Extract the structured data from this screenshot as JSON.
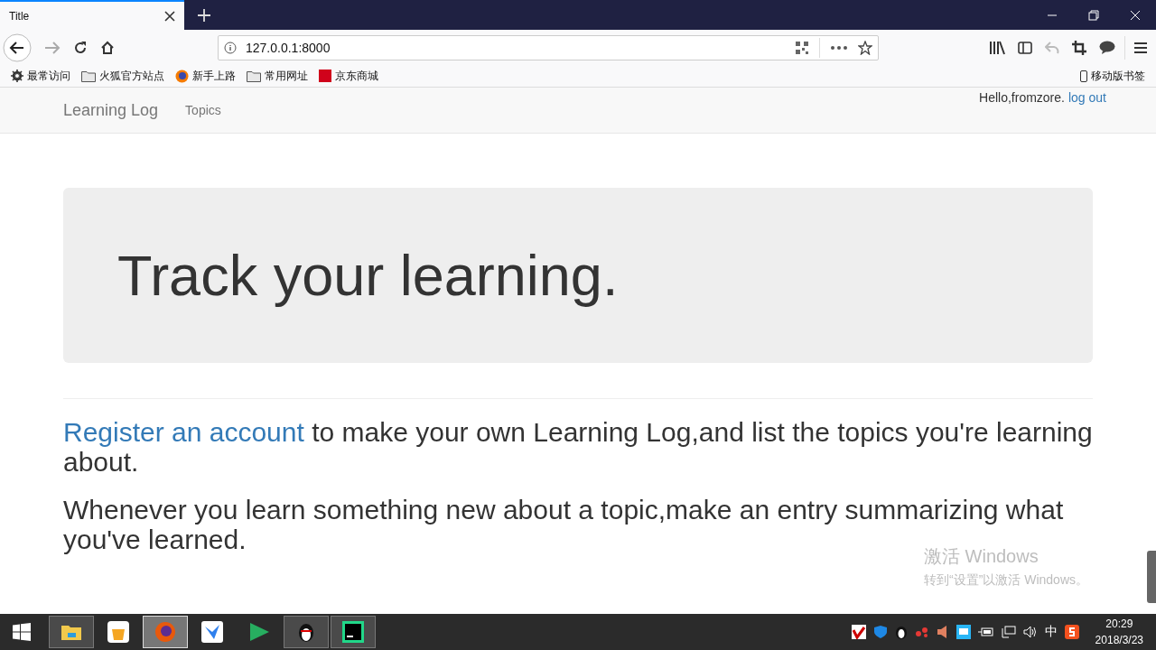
{
  "browser": {
    "tab_title": "Title",
    "url": "127.0.0.1:8000",
    "bookmarks": [
      {
        "kind": "gear",
        "label": "最常访问"
      },
      {
        "kind": "folder",
        "label": "火狐官方站点"
      },
      {
        "kind": "globe",
        "label": "新手上路"
      },
      {
        "kind": "folder",
        "label": "常用网址"
      },
      {
        "kind": "jd",
        "label": "京东商城"
      }
    ],
    "mobile_bookmarks": "移动版书签"
  },
  "navbar": {
    "brand": "Learning Log",
    "links": [
      "Topics"
    ],
    "greeting": "Hello,fromzore.",
    "logout": "log out"
  },
  "jumbotron": {
    "heading": "Track your learning."
  },
  "paragraphs": [
    {
      "link": "Register an account",
      "text": " to make your own Learning Log,and list the topics you're learning about."
    },
    {
      "text": "Whenever you learn something new about a topic,make an entry summarizing what you've learned."
    }
  ],
  "activation": {
    "title": "激活 Windows",
    "hint": "转到“设置”以激活 Windows。"
  },
  "taskbar": {
    "apps": [
      {
        "kind": "explorer",
        "running": true,
        "selected": false
      },
      {
        "kind": "store",
        "running": false,
        "selected": false
      },
      {
        "kind": "firefox",
        "running": true,
        "selected": true
      },
      {
        "kind": "bird",
        "running": false,
        "selected": false
      },
      {
        "kind": "play",
        "running": false,
        "selected": false
      },
      {
        "kind": "penguin",
        "running": true,
        "selected": false
      },
      {
        "kind": "pycharm",
        "running": true,
        "selected": false
      }
    ],
    "ime": "中",
    "time": "20:29",
    "date": "2018/3/23"
  }
}
